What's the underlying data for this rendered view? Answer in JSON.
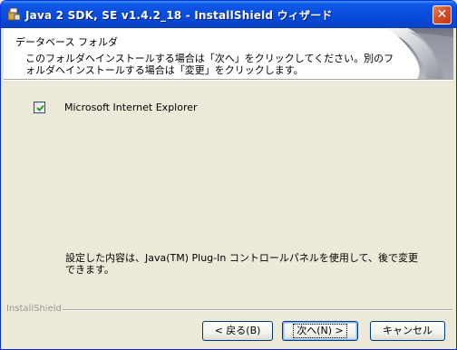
{
  "window": {
    "title": "Java 2 SDK, SE v1.4.2_18 - InstallShield ウィザード"
  },
  "header": {
    "title": "データベース フォルダ",
    "description_line1": "このフォルダへインストールする場合は「次へ」をクリックしてください。別のフ",
    "description_line2": "ォルダへインストールする場合は「変更」をクリックします。"
  },
  "options": [
    {
      "label": "Microsoft Internet Explorer",
      "checked": true
    }
  ],
  "note": {
    "line1": "設定した内容は、Java(TM) Plug-In コントロールパネルを使用して、後で変更",
    "line2": "できます。"
  },
  "footer": {
    "brand": "InstallShield",
    "back_label": "< 戻る(B)",
    "next_label": "次へ(N) >",
    "cancel_label": "キャンセル"
  },
  "icons": {
    "title": "installer-icon",
    "close": "close-icon",
    "check": "checkmark-icon",
    "header": "header-graphic-icon"
  },
  "colors": {
    "titlebar": "#0a4fe0",
    "window_bg": "#ece9d8",
    "close_button": "#d8502a",
    "checkmark": "#21a121"
  }
}
